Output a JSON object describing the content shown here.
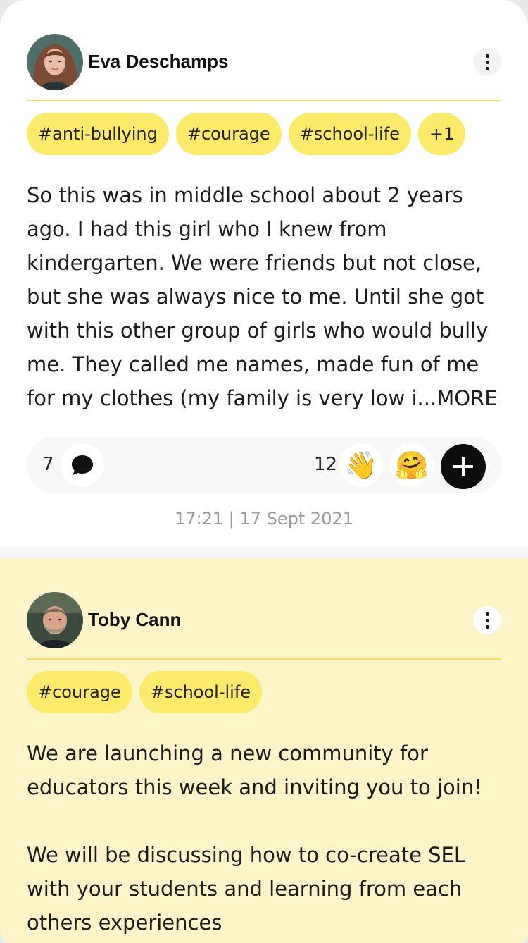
{
  "posts": [
    {
      "author": "Eva Deschamps",
      "tags": [
        "#anti-bullying",
        "#courage",
        "#school-life",
        "+1"
      ],
      "text": "So this was in middle school about 2 years ago. I had this girl who I knew from kindergarten. We were friends but not close, but she was always nice to me. Until she got with this other group of girls who would bully me. They called me names, made fun of me for my clothes (my family is very low i...MORE",
      "comment_count": "7",
      "reaction_count": "12",
      "timestamp": "17:21 | 17 Sept 2021"
    },
    {
      "author": "Toby Cann",
      "tags": [
        "#courage",
        "#school-life"
      ],
      "text": "We are launching a new community for educators this week and inviting you to join!\n\nWe will be discussing how to co-create SEL with your students and learning from each others experiences"
    }
  ],
  "icons": {
    "more": "more-vertical-icon",
    "comment": "chat-bubble-icon",
    "wave": "waving-hand-emoji",
    "hug": "hugging-face-emoji",
    "add": "plus-icon"
  },
  "colors": {
    "tag_bg": "#fde96a",
    "divider": "#f3dc5c",
    "highlight_card": "#fdf4c7"
  }
}
